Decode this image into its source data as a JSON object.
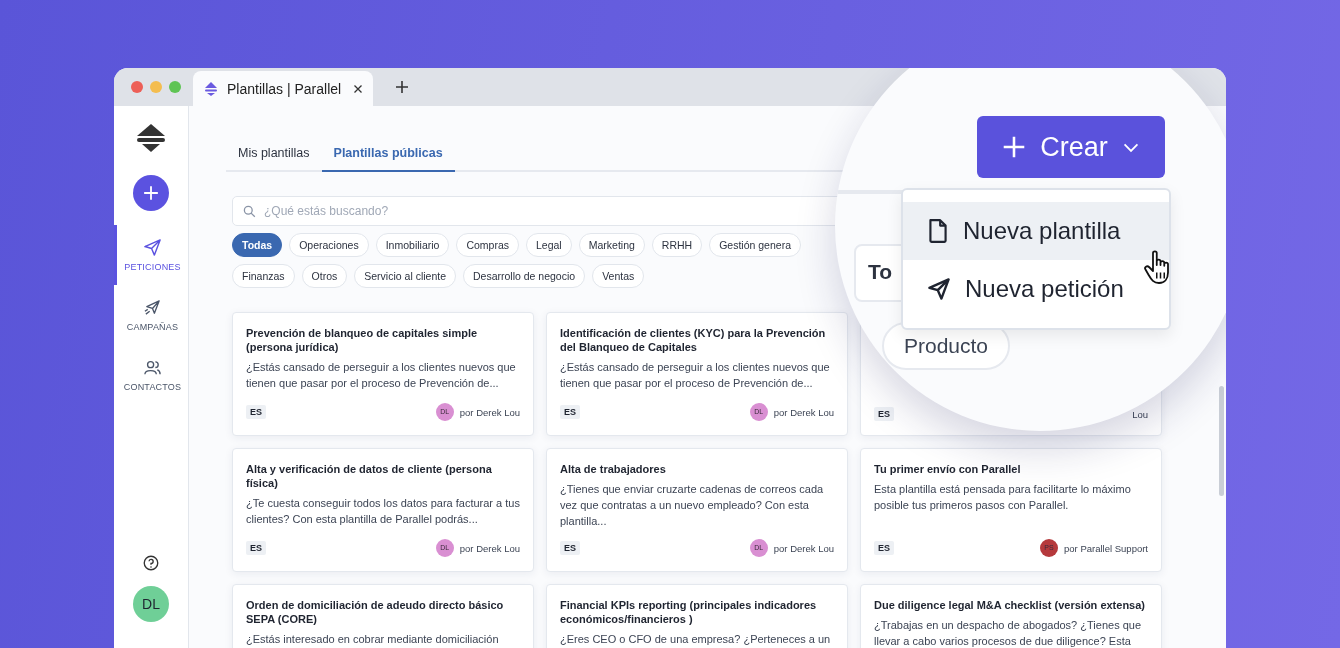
{
  "browser": {
    "tab_title": "Plantillas | Parallel"
  },
  "sidebar": {
    "items": [
      {
        "label": "PETICIONES",
        "kind": "requests",
        "selected": true
      },
      {
        "label": "CAMPAÑAS",
        "kind": "campaigns",
        "selected": false
      },
      {
        "label": "CONTACTOS",
        "kind": "contacts",
        "selected": false
      }
    ],
    "user_initials": "DL"
  },
  "tabs": [
    {
      "label": "Mis plantillas",
      "selected": false
    },
    {
      "label": "Plantillas públicas",
      "selected": true
    }
  ],
  "search": {
    "placeholder": "¿Qué estás buscando?"
  },
  "filters": [
    [
      {
        "label": "Todas",
        "selected": true
      },
      {
        "label": "Operaciones",
        "selected": false
      },
      {
        "label": "Inmobiliario",
        "selected": false
      },
      {
        "label": "Compras",
        "selected": false
      },
      {
        "label": "Legal",
        "selected": false
      },
      {
        "label": "Marketing",
        "selected": false
      },
      {
        "label": "RRHH",
        "selected": false
      },
      {
        "label": "Gestión genera",
        "selected": false
      }
    ],
    [
      {
        "label": "Finanzas",
        "selected": false
      },
      {
        "label": "Otros",
        "selected": false
      },
      {
        "label": "Servicio al cliente",
        "selected": false
      },
      {
        "label": "Desarrollo de negocio",
        "selected": false
      },
      {
        "label": "Ventas",
        "selected": false
      }
    ]
  ],
  "cards": [
    {
      "title": "Prevención de blanqueo de capitales simple (persona jurídica)",
      "description": "¿Estás cansado de perseguir a los clientes nuevos que tienen que pasar por el proceso de Prevención de...",
      "lang": "ES",
      "avatar": "DL",
      "color": "#d98fd2",
      "author": "por Derek Lou"
    },
    {
      "title": "Identificación de clientes (KYC) para la Prevención del Blanqueo de Capitales",
      "description": "¿Estás cansado de perseguir a los clientes nuevos que tienen que pasar por el proceso de Prevención de...",
      "lang": "ES",
      "avatar": "DL",
      "color": "#d98fd2",
      "author": "por Derek Lou"
    },
    {
      "lang": "ES",
      "author": "Lou"
    },
    {
      "title": "Alta y verificación de datos de cliente (persona física)",
      "description": "¿Te cuesta conseguir todos los datos para facturar a tus clientes? Con esta plantilla de Parallel podrás...",
      "lang": "ES",
      "avatar": "DL",
      "color": "#d98fd2",
      "author": "por Derek Lou"
    },
    {
      "title": "Alta de trabajadores",
      "description": "¿Tienes que enviar cruzarte cadenas de correos cada vez que contratas a un nuevo empleado? Con esta plantilla...",
      "lang": "ES",
      "avatar": "DL",
      "color": "#d98fd2",
      "author": "por Derek Lou"
    },
    {
      "title": "Tu primer envío con Parallel",
      "description": "Esta plantilla está pensada para facilitarte lo máximo posible tus primeros pasos con Parallel.",
      "lang": "ES",
      "avatar": "PS",
      "color": "#b5393c",
      "author": "por Parallel Support"
    },
    {
      "title": "Orden de domiciliación de adeudo directo básico SEPA (CORE)",
      "description": "¿Estás interesado en cobrar mediante domiciliación"
    },
    {
      "title": "Financial KPIs reporting (principales indicadores económicos/financieros )",
      "description": "¿Eres CEO o CFO de una empresa? ¿Perteneces a un"
    },
    {
      "title": "Due diligence legal M&A checklist (versión extensa)",
      "description": "¿Trabajas en un despacho de abogados? ¿Tienes que llevar a cabo varios procesos de due diligence? Esta"
    }
  ],
  "magnifier": {
    "create_button": "Crear",
    "chips": [
      "To",
      "Producto"
    ],
    "menu": [
      {
        "label": "Nueva plantilla",
        "kind": "template",
        "selected": true
      },
      {
        "label": "Nueva petición",
        "kind": "request",
        "selected": false
      }
    ]
  }
}
